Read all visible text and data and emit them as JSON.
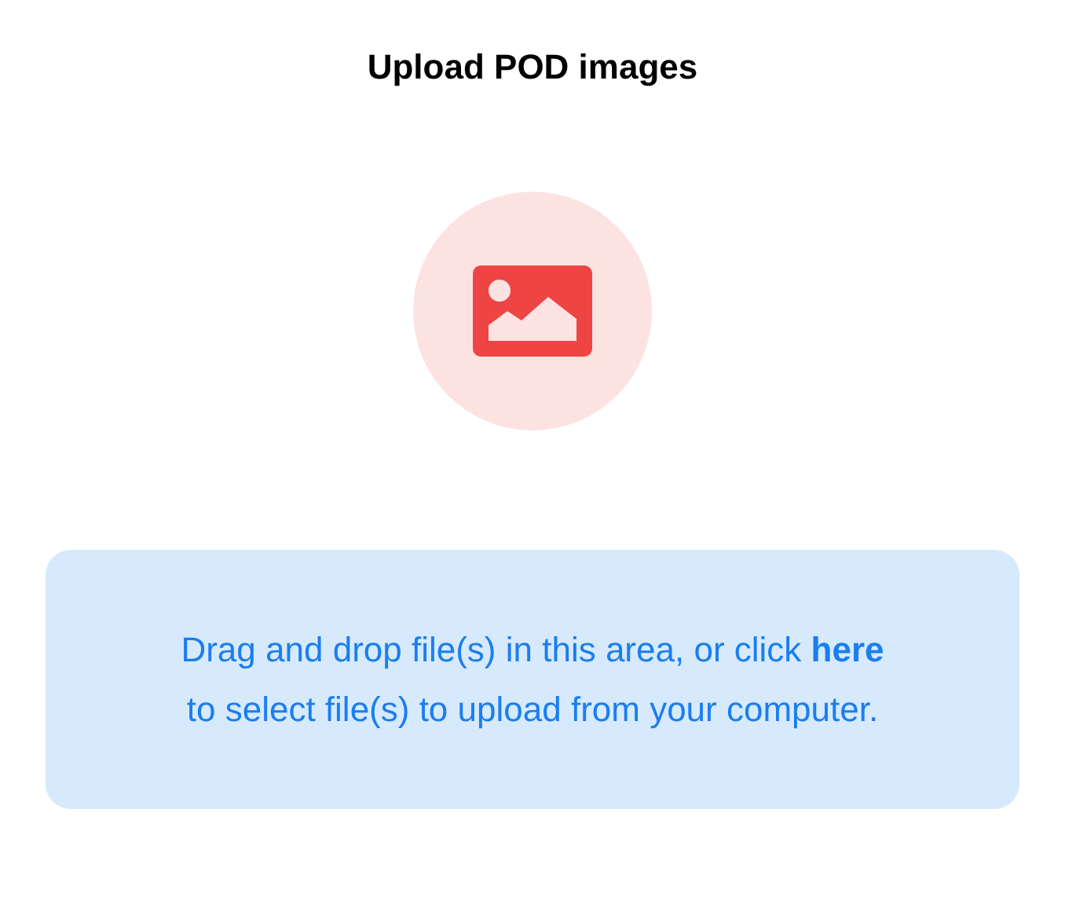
{
  "title": "Upload POD images",
  "dropzone": {
    "text_before": "Drag and drop file(s) in this area, or click",
    "link": "here",
    "text_after": "to select file(s) to upload from your computer."
  }
}
